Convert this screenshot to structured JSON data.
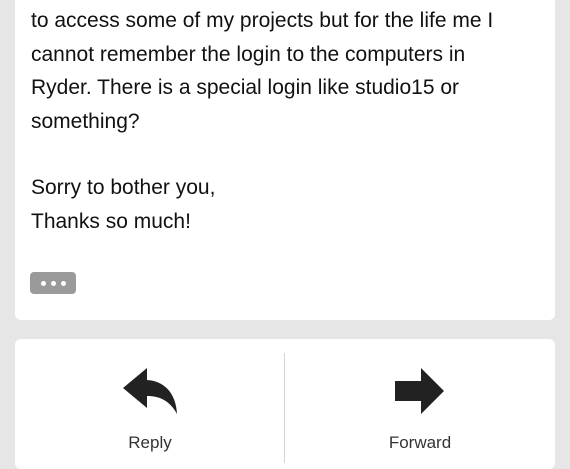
{
  "message": {
    "paragraph_lines": [
      "to access some of my projects but for the life me I",
      "cannot remember the login to the computers in",
      "Ryder. There is a special login like studio15 or",
      "something?"
    ],
    "closing_line_1": "Sorry to bother you,",
    "closing_line_2": "Thanks so much!",
    "trimmed_content_icon": "ellipsis-icon"
  },
  "actions": {
    "reply": {
      "label": "Reply",
      "icon": "reply-arrow-icon"
    },
    "forward": {
      "label": "Forward",
      "icon": "forward-arrow-icon"
    }
  },
  "colors": {
    "background": "#e6e6e6",
    "card": "#ffffff",
    "text": "#111111",
    "icon": "#222222",
    "ellipsis_badge": "#9a9a9a"
  }
}
